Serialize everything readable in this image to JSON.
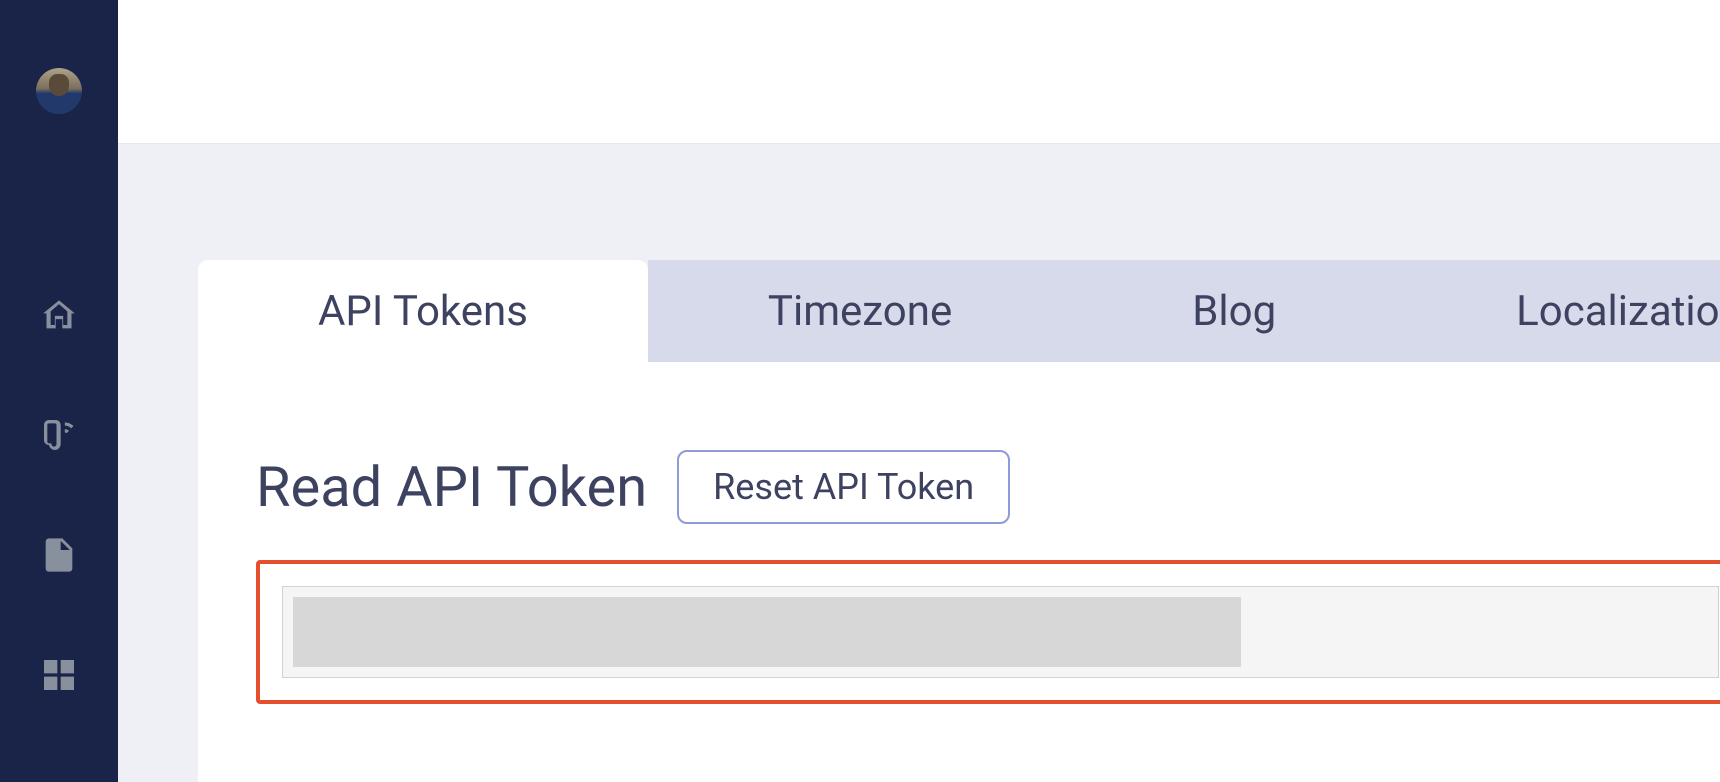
{
  "sidebar": {
    "avatar_alt": "User avatar",
    "items": [
      {
        "name": "home",
        "label": "Home"
      },
      {
        "name": "blog",
        "label": "Blog"
      },
      {
        "name": "file",
        "label": "Files"
      },
      {
        "name": "grid",
        "label": "Dashboard"
      }
    ]
  },
  "tabs": [
    {
      "label": "API Tokens",
      "active": true
    },
    {
      "label": "Timezone",
      "active": false
    },
    {
      "label": "Blog",
      "active": false
    },
    {
      "label": "Localization",
      "active": false
    }
  ],
  "panel": {
    "heading": "Read API Token",
    "reset_label": "Reset API Token",
    "token_value": ""
  }
}
